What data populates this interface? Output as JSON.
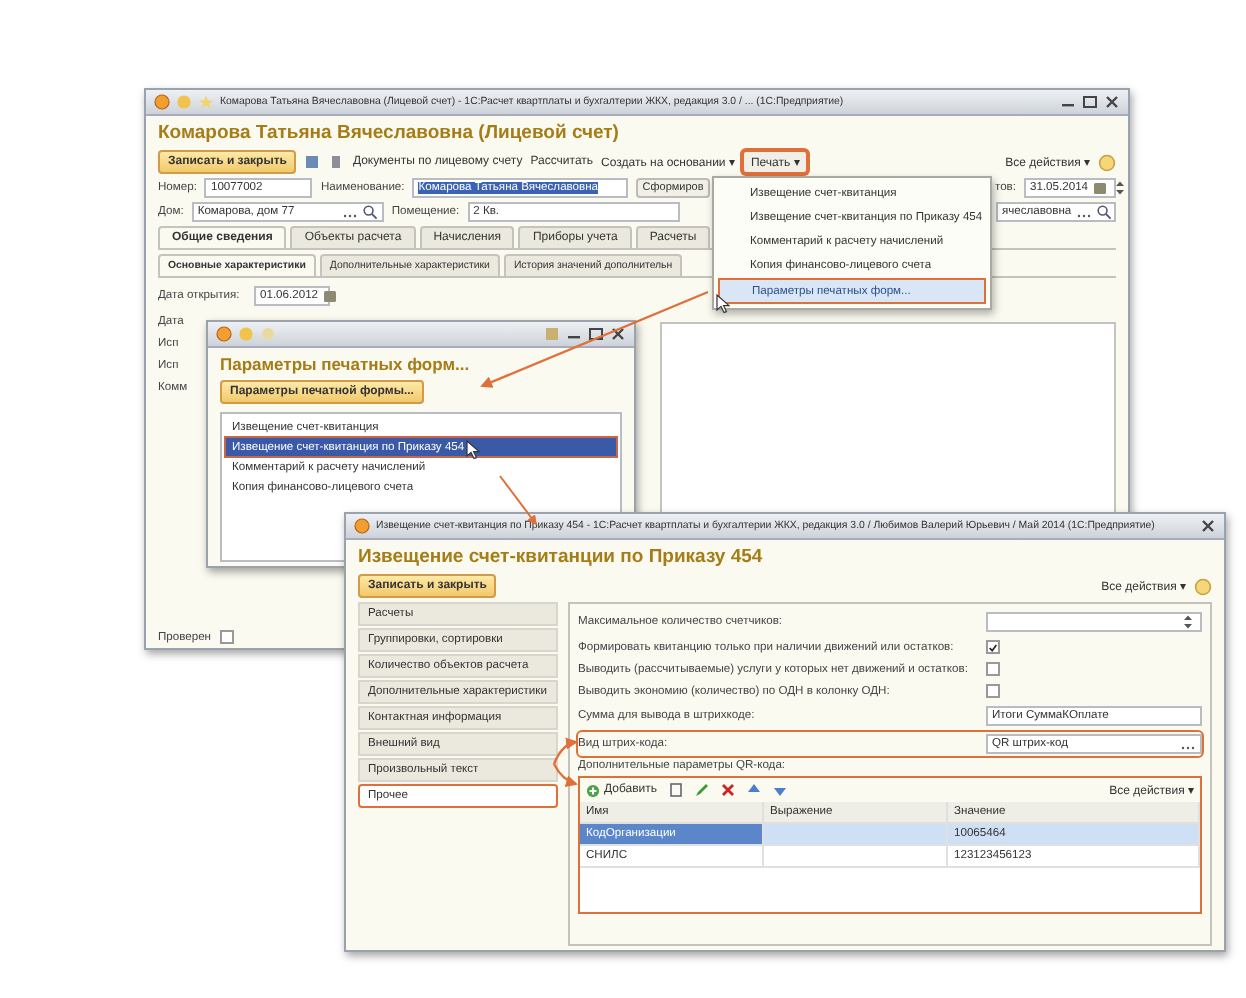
{
  "account_window": {
    "title": "Комарова Татьяна Вячеславовна (Лицевой счет) - 1С:Расчет квартплаты и бухгалтерии ЖКХ, редакция 3.0 / ... (1С:Предприятие)",
    "heading": "Комарова Татьяна Вячеславовна (Лицевой счет)",
    "save_button": "Записать и закрыть",
    "links": [
      {
        "label": "Документы по лицевому счету"
      },
      {
        "label": "Рассчитать"
      },
      {
        "label": "Создать на основании",
        "caret": "▾"
      }
    ],
    "print_button": {
      "label": "Печать",
      "caret": "▾",
      "highlighted": true
    },
    "all_actions": "Все действия",
    "all_actions_caret": "▾",
    "number_label": "Номер:",
    "number": "10077002",
    "name_label": "Наименование:",
    "name": {
      "value": "Комарова Татьяна Вячеславовна",
      "text_selected": true
    },
    "form_button": "Сформиров",
    "date_label": "тов:",
    "date": "31.05.2014",
    "house_label": "Дом:",
    "house": "Комарова, дом 77",
    "room_label": "Помещение:",
    "room": "2 Кв.",
    "person": "ячеславовна",
    "tabs": [
      {
        "label": "Общие сведения",
        "selected": true
      },
      {
        "label": "Объекты расчета",
        "selected": false
      },
      {
        "label": "Начисления",
        "selected": false
      },
      {
        "label": "Приборы учета",
        "selected": false
      },
      {
        "label": "Расчеты",
        "selected": false
      }
    ],
    "subtabs": [
      {
        "label": "Основные характеристики",
        "selected": true
      },
      {
        "label": "Дополнительные характеристики",
        "selected": false
      },
      {
        "label": "История значений дополнительн",
        "selected": false
      }
    ],
    "open_date_label": "Дата открытия:",
    "open_date": "01.06.2012",
    "field_labels": [
      "Дата",
      "Исп",
      "Исп",
      "Комм"
    ],
    "checked_label": "Проверен",
    "checked": false
  },
  "print_menu": {
    "items": [
      {
        "label": "Извещение счет-квитанция",
        "selected": false
      },
      {
        "label": "Извещение счет-квитанция по Приказу 454",
        "selected": false
      },
      {
        "label": "Комментарий к расчету начислений",
        "selected": false
      },
      {
        "label": "Копия финансово-лицевого счета",
        "selected": false
      },
      {
        "label": "Параметры печатных форм...",
        "selected": true
      }
    ]
  },
  "print_forms_window": {
    "heading": "Параметры печатных форм...",
    "button": "Параметры печатной формы...",
    "items": [
      {
        "label": "Извещение счет-квитанция",
        "selected": false
      },
      {
        "label": "Извещение счет-квитанция по Приказу 454",
        "selected": true
      },
      {
        "label": "Комментарий к расчету начислений",
        "selected": false
      },
      {
        "label": "Копия финансово-лицевого счета",
        "selected": false
      }
    ]
  },
  "receipt_window": {
    "title": "Извещение счет-квитанция по Приказу 454 - 1С:Расчет квартплаты и бухгалтерии ЖКХ, редакция 3.0 / Любимов Валерий Юрьевич / Май 2014 (1С:Предприятие)",
    "heading": "Извещение счет-квитанции по Приказу 454",
    "save_button": "Записать и закрыть",
    "all_actions": "Все действия",
    "all_actions_caret": "▾",
    "sections": [
      {
        "label": "Расчеты",
        "selected": false
      },
      {
        "label": "Группировки, сортировки",
        "selected": false
      },
      {
        "label": "Количество объектов расчета",
        "selected": false
      },
      {
        "label": "Дополнительные характеристики",
        "selected": false
      },
      {
        "label": "Контактная информация",
        "selected": false
      },
      {
        "label": "Внешний вид",
        "selected": false
      },
      {
        "label": "Произвольный текст",
        "selected": false
      },
      {
        "label": "Прочее",
        "selected": true
      }
    ],
    "settings": [
      {
        "kind": "number",
        "label": "Максимальное количество счетчиков:"
      },
      {
        "kind": "checkbox",
        "label": "Формировать квитанцию только при наличии движений или остатков:",
        "checked": true
      },
      {
        "kind": "checkbox",
        "label": "Выводить (рассчитываемые) услуги у которых нет движений и остатков:",
        "checked": false
      },
      {
        "kind": "checkbox",
        "label": "Выводить экономию (количество) по ОДН в колонку ОДН:",
        "checked": false
      },
      {
        "kind": "text",
        "label": "Сумма для вывода в штрихкоде:",
        "value": "Итоги СуммаКОплате",
        "highlighted": false
      },
      {
        "kind": "choice",
        "label": "Вид штрих-кода:",
        "value": "QR штрих-код",
        "highlighted": true
      }
    ],
    "qr_params_label": "Дополнительные параметры QR-кода:",
    "add_button": "Добавить",
    "table_all_actions": "Все действия",
    "table_all_actions_caret": "▾",
    "table_highlighted": true,
    "table": {
      "columns": [
        "Имя",
        "Выражение",
        "Значение"
      ],
      "rows": [
        {
          "name": "КодОрганизации",
          "value": "10065464",
          "selected": true
        },
        {
          "name": "СНИЛС",
          "value": "123123456123",
          "selected": false
        }
      ]
    }
  }
}
